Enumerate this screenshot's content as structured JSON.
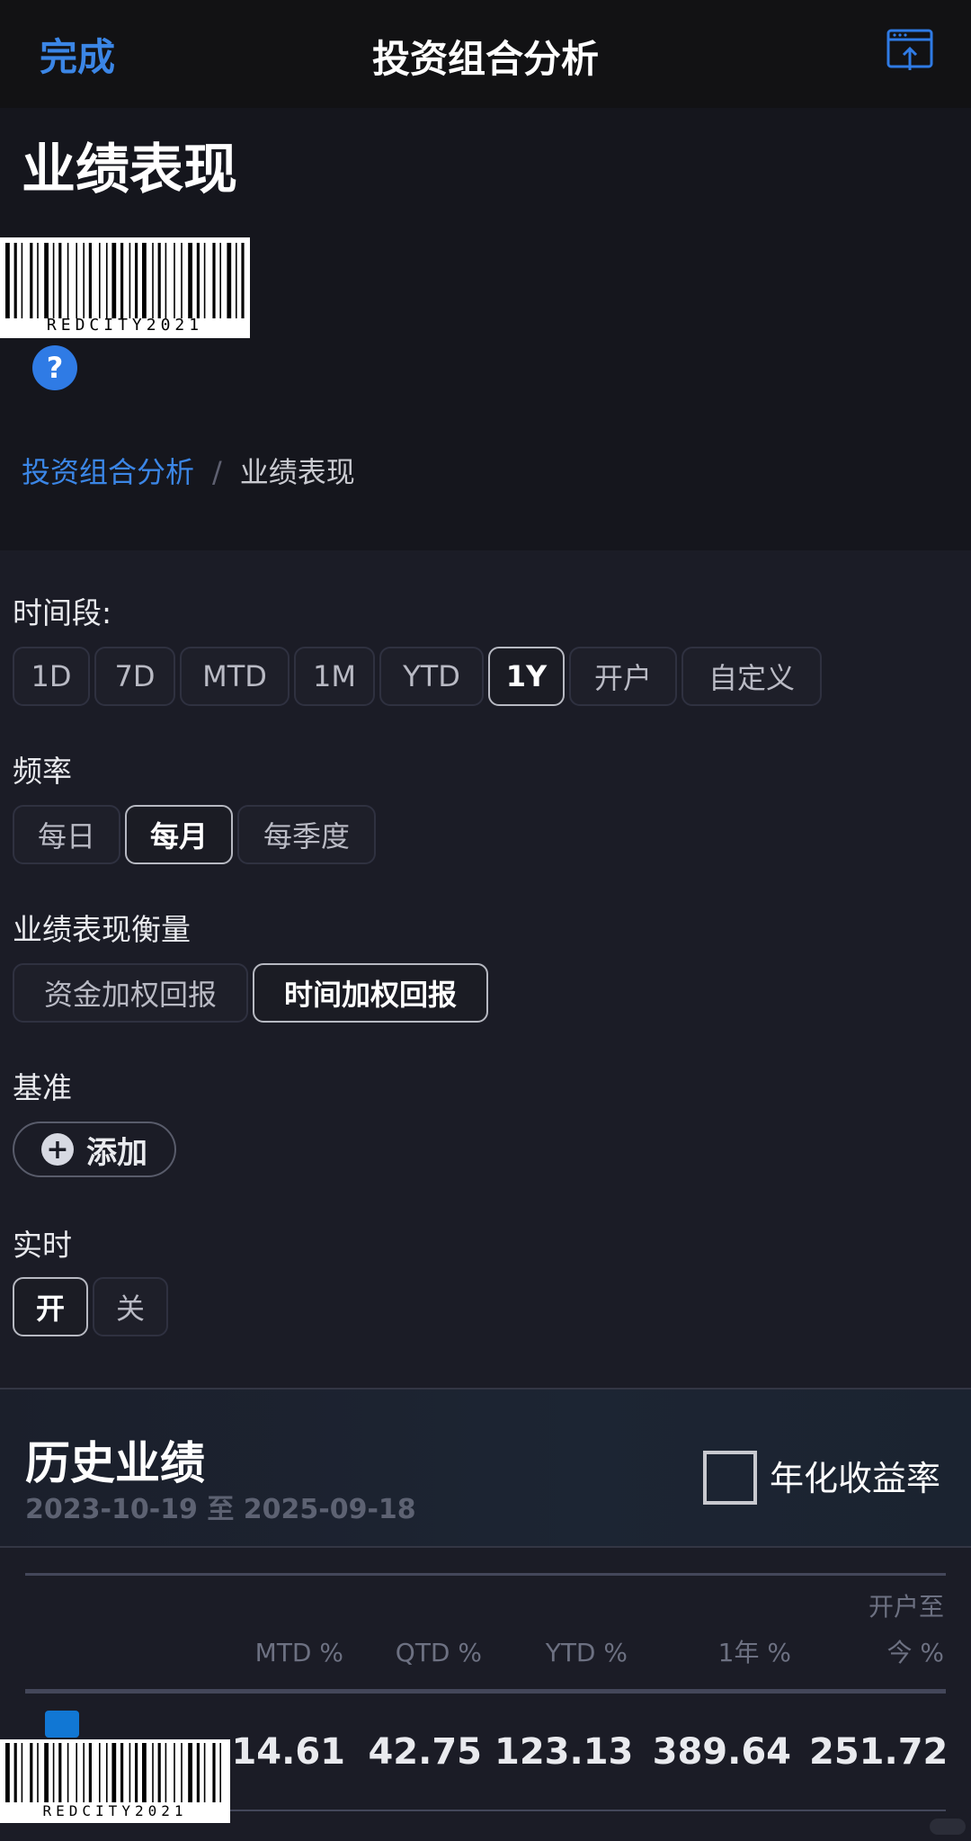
{
  "nav": {
    "done_label": "完成",
    "title": "投资组合分析",
    "share_icon": "share-window-icon"
  },
  "header": {
    "title": "业绩表现",
    "barcode_text": "REDCITY2021",
    "help_icon_glyph": "?",
    "breadcrumb": {
      "parent": "投资组合分析",
      "separator": "/",
      "current": "业绩表现"
    }
  },
  "filters": {
    "period": {
      "label": "时间段:",
      "options": [
        "1D",
        "7D",
        "MTD",
        "1M",
        "YTD",
        "1Y",
        "开户",
        "自定义"
      ],
      "selected": "1Y"
    },
    "frequency": {
      "label": "频率",
      "options": [
        "每日",
        "每月",
        "每季度"
      ],
      "selected": "每月"
    },
    "measure": {
      "label": "业绩表现衡量",
      "options": [
        "资金加权回报",
        "时间加权回报"
      ],
      "selected": "时间加权回报"
    },
    "benchmark": {
      "label": "基准",
      "add_label": "添加",
      "add_icon": "plus-circle-icon"
    },
    "realtime": {
      "label": "实时",
      "options": [
        "开",
        "关"
      ],
      "selected": "开"
    }
  },
  "history": {
    "title": "历史业绩",
    "date_range": "2023-10-19 至 2025-09-18",
    "annualized_label": "年化收益率",
    "annualized_checked": false,
    "columns": [
      "MTD %",
      "QTD %",
      "YTD %",
      "1年 %",
      "开户至",
      "今 %"
    ],
    "row": {
      "swatch_color": "#1177d4",
      "values": [
        "14.61",
        "42.75",
        "123.13",
        "389.64",
        "251.72"
      ]
    }
  },
  "colors": {
    "accent": "#3b86e6",
    "background": "#1b1c26",
    "navbar": "#121214"
  }
}
